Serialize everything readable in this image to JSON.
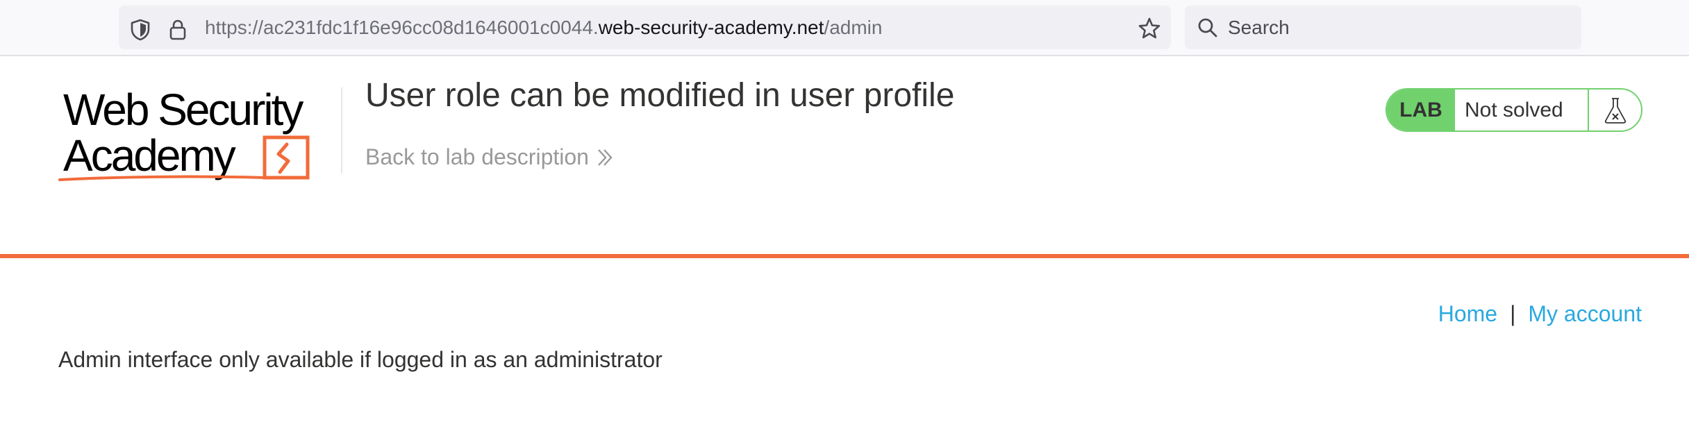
{
  "browser": {
    "url_prefix": "https://ac231fdc1f16e96cc08d1646001c0044.",
    "url_host": "web-security-academy.net",
    "url_path": "/admin",
    "search_placeholder": "Search"
  },
  "logo": {
    "line1": "Web Security",
    "line2": "Academy"
  },
  "lab": {
    "title": "User role can be modified in user profile",
    "back_link": "Back to lab description",
    "badge": "LAB",
    "status": "Not solved"
  },
  "nav": {
    "home": "Home",
    "separator": "|",
    "my_account": "My account"
  },
  "content": {
    "message": "Admin interface only available if logged in as an administrator"
  },
  "colors": {
    "accent_orange": "#f26b3a",
    "status_green": "#70d16d",
    "link_blue": "#29a8e0"
  }
}
